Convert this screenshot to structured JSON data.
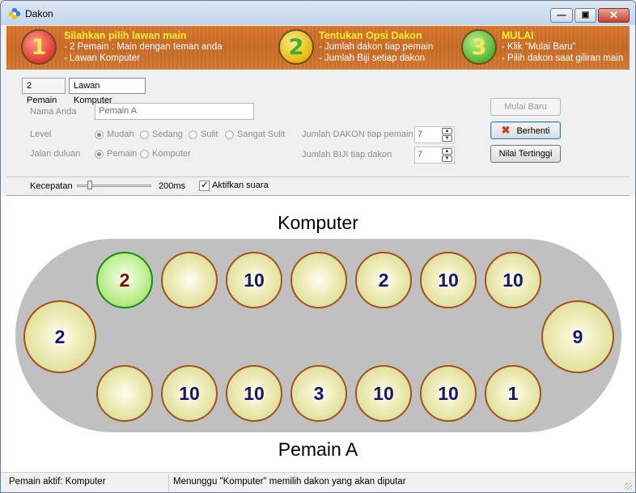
{
  "window": {
    "title": "Dakon",
    "icon": "flower-app-icon"
  },
  "banner": {
    "steps": [
      {
        "number": "1",
        "heading": "Silahkan pilih lawan main",
        "lines": [
          "- 2 Pemain : Main dengan teman anda",
          "- Lawan Komputer"
        ]
      },
      {
        "number": "2",
        "heading": "Tentukan Opsi Dakon",
        "lines": [
          "- Jumlah dakon tiap pemain",
          "- Jumlah Biji setiap dakon"
        ]
      },
      {
        "number": "3",
        "heading": "MULAI",
        "lines": [
          "- Klik “Mulai Baru”",
          "- Pilih dakon saat giliran main"
        ]
      }
    ]
  },
  "tabs": [
    {
      "label": "2 Pemain",
      "selected": false
    },
    {
      "label": "Lawan Komputer",
      "selected": true
    }
  ],
  "form": {
    "name_label": "Nama Anda",
    "name_value": "Pemain A",
    "level_label": "Level",
    "level_options": [
      "Mudah",
      "Sedang",
      "Sulit",
      "Sangat Sulit"
    ],
    "level_selected": "Mudah",
    "first_label": "Jalan duluan",
    "first_options": [
      "Pemain",
      "Komputer"
    ],
    "first_selected": "Pemain",
    "pits_label": "Jumlah DAKON tiap pemain",
    "pits_value": "7",
    "seeds_label": "Jumlah BIJI tiap dakon",
    "seeds_value": "7"
  },
  "buttons": {
    "new_game": "Mulai Baru",
    "stop": "Berhenti",
    "high_score": "Nilai Tertinggi"
  },
  "speed": {
    "label": "Kecepatan",
    "value_text": "200ms",
    "level": 0.15
  },
  "sound": {
    "label": "Aktifkan suara",
    "checked": true
  },
  "board": {
    "top_player": "Komputer",
    "bottom_player": "Pemain A",
    "top_row": [
      "2",
      "",
      "10",
      "",
      "2",
      "10",
      "10"
    ],
    "bottom_row": [
      "",
      "10",
      "10",
      "3",
      "10",
      "10",
      "1"
    ],
    "left_store": "2",
    "right_store": "9",
    "active_pit": "top-0",
    "colors": {
      "pit_border": "#a0531a",
      "seed_count": "#16156f",
      "active_border": "#1b8a1b",
      "board_bg": "#c0c0c0"
    }
  },
  "status": {
    "active_player": "Pemain aktif: Komputer",
    "message": "Menunggu \"Komputer\" memilih dakon yang akan diputar"
  }
}
